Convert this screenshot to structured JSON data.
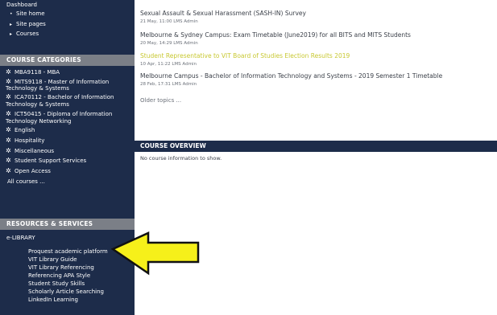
{
  "sidebar": {
    "nav": {
      "dashboard": "Dashboard",
      "items": [
        "Site home",
        "Site pages",
        "Courses"
      ]
    },
    "categories_heading": "COURSE CATEGORIES",
    "categories": [
      {
        "line1": "MBA9118 - MBA",
        "line2": ""
      },
      {
        "line1": "MITS9118 - Master of Information",
        "line2": "Technology & Systems"
      },
      {
        "line1": "ICA70112 - Bachelor of Information",
        "line2": "Technology & Systems"
      },
      {
        "line1": "ICT50415 - Diploma of Information",
        "line2": "Technology Networking"
      },
      {
        "line1": "English",
        "line2": ""
      },
      {
        "line1": "Hospitality",
        "line2": ""
      },
      {
        "line1": "Miscellaneous",
        "line2": ""
      },
      {
        "line1": "Student Support Services",
        "line2": ""
      },
      {
        "line1": "Open Access",
        "line2": ""
      }
    ],
    "all_courses": "All courses ...",
    "resources_heading": "RESOURCES & SERVICES",
    "elibrary": "e-LIBRARY",
    "library_links": [
      "Proquest academic platform",
      "VIT Library Guide",
      "VIT Library Referencing",
      "Referencing APA Style",
      "Student Study Skills",
      "Scholarly Article Searching",
      "LinkedIn Learning"
    ]
  },
  "main": {
    "topics": [
      {
        "title": "Sexual Assault & Sexual Harassment (SASH-IN) Survey",
        "meta": "21 May, 11:00 LMS Admin",
        "highlight": false
      },
      {
        "title": "Melbourne & Sydney Campus: Exam Timetable (June2019) for all BITS and MITS Students",
        "meta": "20 May, 14:29 LMS Admin",
        "highlight": false
      },
      {
        "title": "Student Representative to VIT Board of Studies Election Results 2019",
        "meta": "10 Apr, 11:22 LMS Admin",
        "highlight": true
      },
      {
        "title": "Melbourne Campus - Bachelor of Information Technology and Systems - 2019 Semester 1 Timetable",
        "meta": "28 Feb, 17:31 LMS Admin",
        "highlight": false
      }
    ],
    "older_topics": "Older topics ...",
    "overview_heading": "COURSE OVERVIEW",
    "overview_body": "No course information to show."
  },
  "colors": {
    "sidebar_bg": "#1d2c4a",
    "section_header_bg": "#7b7f87",
    "highlight_topic": "#c8c832",
    "arrow_fill": "#f6f01a"
  },
  "icons": {
    "category": "gear-icon",
    "nav_bullet": "triangle-right-icon",
    "pointer": "arrow-left-icon"
  }
}
